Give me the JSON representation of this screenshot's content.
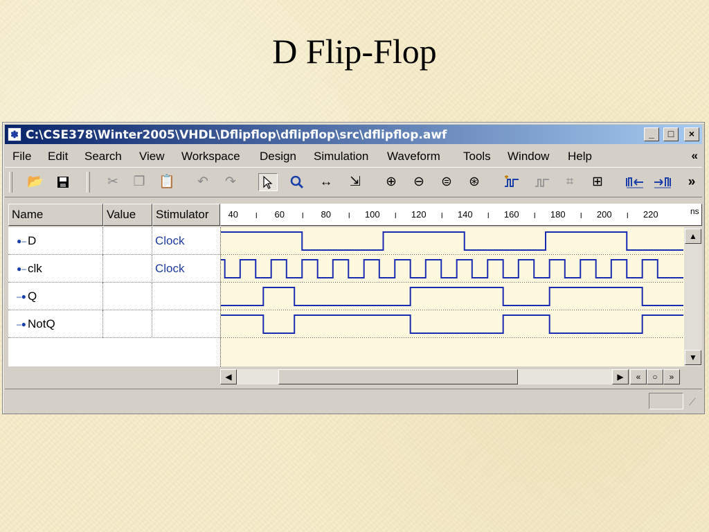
{
  "slide": {
    "title": "D Flip-Flop"
  },
  "window": {
    "title": "C:\\CSE378\\Winter2005\\VHDL\\Dflipflop\\dflipflop\\src\\dflipflop.awf",
    "icon": "app-icon",
    "controls": {
      "minimize": "_",
      "maximize": "□",
      "close": "×"
    }
  },
  "menu": {
    "items": [
      {
        "label": "File"
      },
      {
        "label": "Edit"
      },
      {
        "label": "Search"
      },
      {
        "label": "View"
      },
      {
        "label": "Workspace"
      },
      {
        "label": "Design"
      },
      {
        "label": "Simulation"
      },
      {
        "label": "Waveform"
      },
      {
        "label": "Tools"
      },
      {
        "label": "Window"
      },
      {
        "label": "Help"
      }
    ],
    "chevron": "«"
  },
  "toolbar": {
    "icons": [
      "open-folder-icon",
      "save-icon",
      "cut-icon",
      "copy-icon",
      "paste-icon",
      "undo-icon",
      "redo-icon",
      "select-pointer-icon",
      "zoom-icon",
      "measure-icon",
      "select-range-icon",
      "zoom-in-icon",
      "zoom-out-icon",
      "zoom-fit-icon",
      "zoom-reset-icon",
      "add-signal-icon",
      "remove-signal-icon",
      "bus-icon",
      "compare-icon",
      "goto-start-icon",
      "goto-end-icon"
    ],
    "overflow": "»"
  },
  "columns": {
    "name": "Name",
    "value": "Value",
    "stimulator": "Stimulator"
  },
  "timeline": {
    "labels": [
      "40",
      "60",
      "80",
      "100",
      "120",
      "140",
      "160",
      "180",
      "200",
      "220"
    ],
    "unit": "ns"
  },
  "signals": [
    {
      "name": "D",
      "value": "",
      "stimulator": "Clock",
      "direction": "input",
      "transitions": [
        [
          35,
          1
        ],
        [
          70,
          0
        ],
        [
          105,
          1
        ],
        [
          140,
          0
        ],
        [
          175,
          1
        ],
        [
          210,
          0
        ]
      ]
    },
    {
      "name": "clk",
      "value": "",
      "stimulator": "Clock",
      "direction": "input",
      "transitions": [
        [
          35,
          1
        ],
        [
          36.7,
          0
        ],
        [
          43.3,
          1
        ],
        [
          50,
          0
        ],
        [
          56.7,
          1
        ],
        [
          63.3,
          0
        ],
        [
          70,
          1
        ],
        [
          76.7,
          0
        ],
        [
          83.3,
          1
        ],
        [
          90,
          0
        ],
        [
          96.7,
          1
        ],
        [
          103.3,
          0
        ],
        [
          110,
          1
        ],
        [
          116.7,
          0
        ],
        [
          123.3,
          1
        ],
        [
          130,
          0
        ],
        [
          136.7,
          1
        ],
        [
          143.3,
          0
        ],
        [
          150,
          1
        ],
        [
          156.7,
          0
        ],
        [
          163.3,
          1
        ],
        [
          170,
          0
        ],
        [
          176.7,
          1
        ],
        [
          183.3,
          0
        ],
        [
          190,
          1
        ],
        [
          196.7,
          0
        ],
        [
          203.3,
          1
        ],
        [
          210,
          0
        ],
        [
          216.7,
          1
        ],
        [
          223.3,
          0
        ]
      ]
    },
    {
      "name": "Q",
      "value": "",
      "stimulator": "",
      "direction": "output",
      "transitions": [
        [
          35,
          0
        ],
        [
          53.3,
          1
        ],
        [
          66.7,
          0
        ],
        [
          116.7,
          1
        ],
        [
          156.7,
          0
        ],
        [
          176.7,
          1
        ],
        [
          216.7,
          0
        ]
      ]
    },
    {
      "name": "NotQ",
      "value": "",
      "stimulator": "",
      "direction": "output",
      "transitions": [
        [
          35,
          1
        ],
        [
          53.3,
          0
        ],
        [
          66.7,
          1
        ],
        [
          116.7,
          0
        ],
        [
          156.7,
          1
        ],
        [
          176.7,
          0
        ],
        [
          216.7,
          1
        ]
      ]
    }
  ],
  "colors": {
    "waveform": "#1a2bb0",
    "wave_background": "#fdf8de",
    "title_bar": "#0a246a"
  }
}
